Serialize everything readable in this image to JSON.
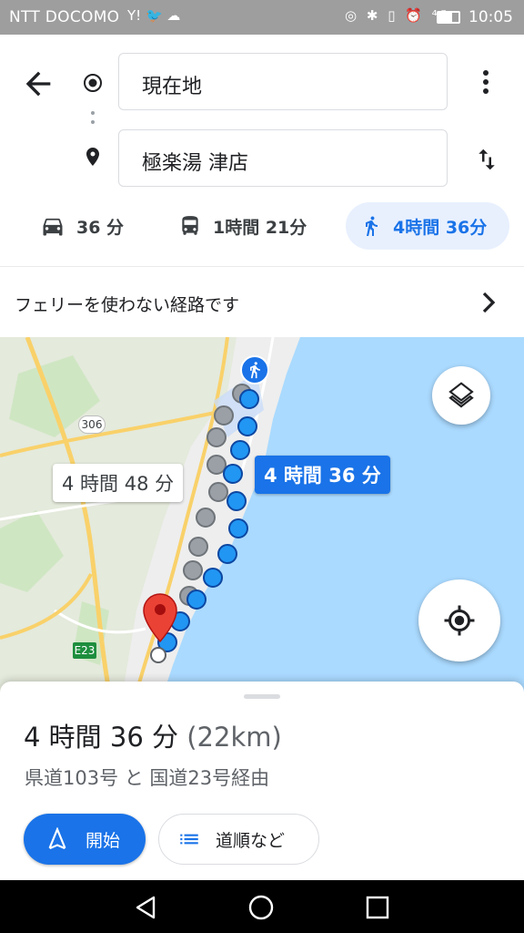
{
  "status_bar": {
    "carrier": "NTT DOCOMO",
    "left_icons": "Y! 🐦 ☁",
    "right_icons": "◎ ✱ ▯ ⏰ ⁴ᴳ",
    "time": "10:05"
  },
  "directions": {
    "origin": "現在地",
    "destination": "極楽湯 津店"
  },
  "travel_modes": [
    {
      "icon": "car-icon",
      "label": "36 分",
      "active": false
    },
    {
      "icon": "bus-icon",
      "label": "1時間 21分",
      "active": false
    },
    {
      "icon": "walk-icon",
      "label": "4時間 36分",
      "active": true
    }
  ],
  "notice": {
    "text": "フェリーを使わない経路です"
  },
  "map": {
    "road_badge_306": "306",
    "road_badge_e23": "E23",
    "alt_route_label": "4 時間 48 分",
    "main_route_label": "4 時間 36 分"
  },
  "summary": {
    "duration": "4 時間 36 分",
    "distance": "(22km)",
    "via": "県道103号 と 国道23号経由",
    "start_label": "開始",
    "steps_label": "道順など"
  },
  "colors": {
    "accent": "#1a73e8",
    "route_dot": "#2196f3",
    "alt_dot": "#9aa0a6",
    "water": "#aadaff"
  }
}
